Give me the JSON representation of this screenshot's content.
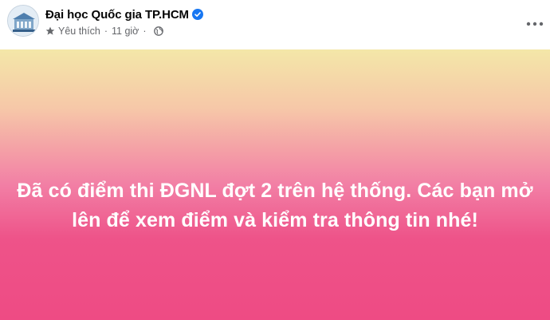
{
  "post": {
    "page_name": "Đại học Quốc gia TP.HCM",
    "verified_icon": "verified-badge-icon",
    "favorite_label": "Yêu thích",
    "separator": "·",
    "time_label": "11 giờ",
    "privacy_icon": "globe-icon",
    "more_icon": "more-options-icon",
    "message": "Đã có điểm thi ĐGNL đợt 2 trên hệ thống. Các bạn mở lên để xem điểm và kiểm tra thông tin nhé!",
    "colors": {
      "name": "#050505",
      "meta": "#65676b",
      "verified": "#1877f2",
      "text": "#ffffff",
      "gradient_top": "#f4e7a8",
      "gradient_bottom": "#ee4b84"
    }
  }
}
